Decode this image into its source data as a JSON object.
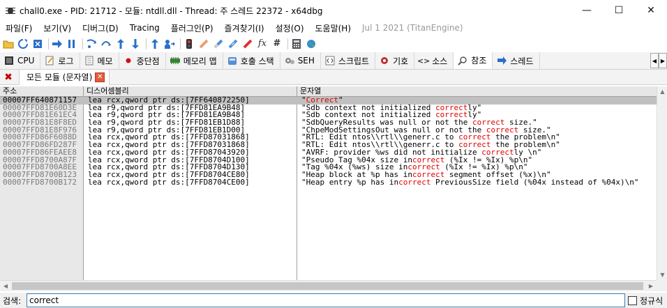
{
  "window": {
    "title": "chall0.exe - PID: 21712 - 모듈: ntdll.dll - Thread: 주 스레드 22372 - x64dbg",
    "minimize": "—",
    "maximize": "☐",
    "close": "✕"
  },
  "menu": {
    "items": [
      "파일(F)",
      "보기(V)",
      "디버그(D)",
      "Tracing",
      "플러그인(P)",
      "즐겨찾기(I)",
      "설정(O)",
      "도움말(H)"
    ],
    "build": "Jul 1 2021 (TitanEngine)"
  },
  "toolbar": {
    "icons": [
      "open-icon",
      "restart-icon",
      "close-debuggee-icon",
      "run-icon",
      "pause-icon",
      "step-into-icon",
      "step-over-icon",
      "trace-into-icon",
      "trace-over-icon",
      "execute-till-return-icon",
      "execute-till-user-code-icon",
      "hide-debugger-icon",
      "comment-icon",
      "label-icon",
      "bookmark-icon",
      "function-icon",
      "hash-icon",
      "calculator-icon",
      "globe-icon"
    ],
    "fx": "fx",
    "hash": "#"
  },
  "tabs": [
    {
      "label": "CPU",
      "icon": "cpu-icon"
    },
    {
      "label": "로그",
      "icon": "log-icon"
    },
    {
      "label": "메모",
      "icon": "notes-icon"
    },
    {
      "label": "중단점",
      "icon": "breakpoint-icon"
    },
    {
      "label": "메모리 맵",
      "icon": "memory-map-icon"
    },
    {
      "label": "호출 스택",
      "icon": "call-stack-icon"
    },
    {
      "label": "SEH",
      "icon": "seh-icon"
    },
    {
      "label": "스크립트",
      "icon": "script-icon"
    },
    {
      "label": "기호",
      "icon": "symbols-icon"
    },
    {
      "label": "소스",
      "icon": "source-icon"
    },
    {
      "label": "참조",
      "icon": "references-icon"
    },
    {
      "label": "스레드",
      "icon": "threads-icon"
    }
  ],
  "subtab": {
    "label": "모든 모듈 (문자열)",
    "close": "✕"
  },
  "table": {
    "headers": [
      "주소",
      "디스어셈블리",
      "문자열"
    ],
    "rows": [
      {
        "addr": "00007FF640871157",
        "dis": "lea rcx,qword ptr ds:[7FF640872250]",
        "str": [
          "\"",
          "Correct",
          "\""
        ],
        "selected": true
      },
      {
        "addr": "00007FFD81E60D3E",
        "dis": "lea r9,qword ptr ds:[7FFD81EA9B48]",
        "str": [
          "\"Sdb context not initialized ",
          "correct",
          "ly\""
        ]
      },
      {
        "addr": "00007FFD81E61EC4",
        "dis": "lea r9,qword ptr ds:[7FFD81EA9B48]",
        "str": [
          "\"Sdb context not initialized ",
          "correct",
          "ly\""
        ]
      },
      {
        "addr": "00007FFD81E8F8ED",
        "dis": "lea r9,qword ptr ds:[7FFD81EB1D88]",
        "str": [
          "\"SdbQueryResults was null or not the ",
          "correct",
          " size.\""
        ]
      },
      {
        "addr": "00007FFD81E8F976",
        "dis": "lea r9,qword ptr ds:[7FFD81EB1D00]",
        "str": [
          "\"ChpeModSettingsOut was null or not the ",
          "correct",
          " size.\""
        ]
      },
      {
        "addr": "00007FFD86F6088D",
        "dis": "lea rcx,qword ptr ds:[7FFD87031868]",
        "str": [
          "\"RTL: Edit ntos\\\\rtl\\\\generr.c to ",
          "correct",
          " the problem\\n\""
        ]
      },
      {
        "addr": "00007FFD86FD287F",
        "dis": "lea rcx,qword ptr ds:[7FFD87031868]",
        "str": [
          "\"RTL: Edit ntos\\\\rtl\\\\generr.c to ",
          "correct",
          " the problem\\n\""
        ]
      },
      {
        "addr": "00007FFD86FEAEE8",
        "dis": "lea rcx,qword ptr ds:[7FFD87043920]",
        "str": [
          "\"AVRF: provider %ws did not initialize ",
          "correct",
          "ly \\n\""
        ]
      },
      {
        "addr": "00007FFD8700A87F",
        "dis": "lea rcx,qword ptr ds:[7FFD8704D100]",
        "str": [
          "\"Pseudo Tag %04x size in",
          "correct",
          " (%Ix != %Ix) %p\\n\""
        ]
      },
      {
        "addr": "00007FFD8700A8EE",
        "dis": "lea rcx,qword ptr ds:[7FFD8704D130]",
        "str": [
          "\"Tag %04x (%ws) size in",
          "correct",
          " (%Ix != %Ix) %p\\n\""
        ]
      },
      {
        "addr": "00007FFD8700B123",
        "dis": "lea rcx,qword ptr ds:[7FFD8704CE80]",
        "str": [
          "\"Heap block at %p has in",
          "correct",
          " segment offset (%x)\\n\""
        ]
      },
      {
        "addr": "00007FFD8700B172",
        "dis": "lea rcx,qword ptr ds:[7FFD8704CE00]",
        "str": [
          "\"Heap entry %p has in",
          "correct",
          " PreviousSize field (%04x instead of %04x)\\n\""
        ]
      }
    ]
  },
  "search": {
    "label": "검색:",
    "value": "correct",
    "regex_label": "정규식"
  },
  "colors": {
    "highlight": "#e00000",
    "selected_row": "#c0c0c0",
    "address_column": "#e8e8e8"
  }
}
